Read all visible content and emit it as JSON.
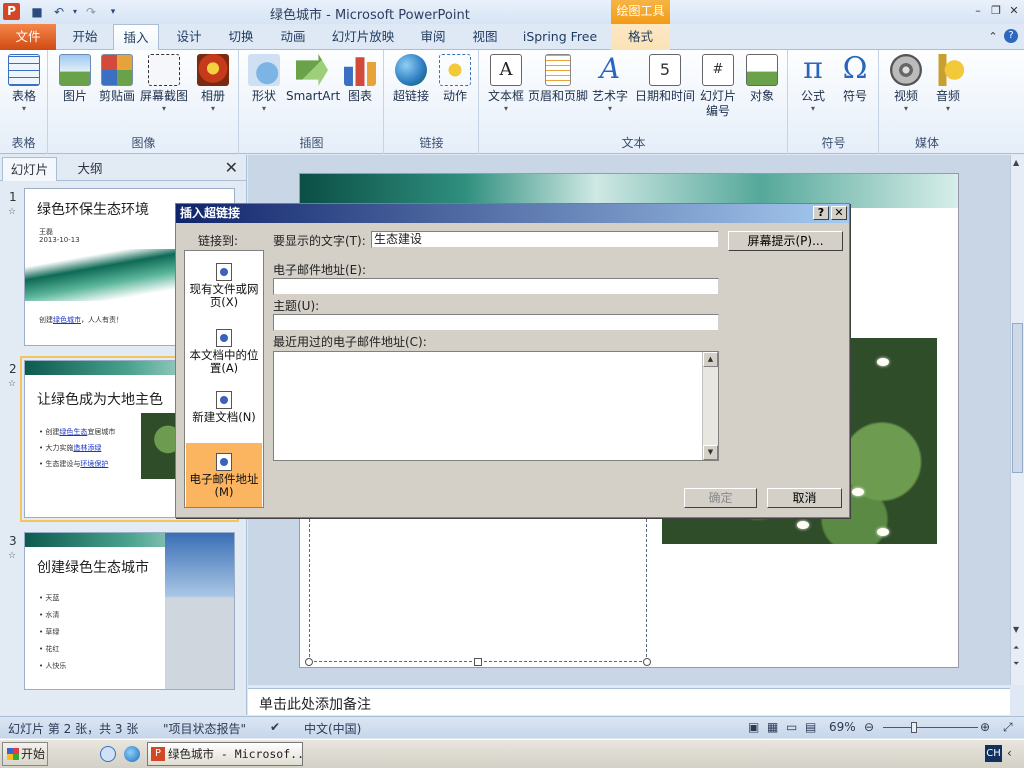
{
  "window": {
    "title": "绿色城市 - Microsoft PowerPoint",
    "app_icon": "P",
    "contextual_tab": "绘图工具"
  },
  "tabs": [
    "文件",
    "开始",
    "插入",
    "设计",
    "切换",
    "动画",
    "幻灯片放映",
    "审阅",
    "视图",
    "iSpring Free",
    "格式"
  ],
  "active_tab": "插入",
  "ribbon": {
    "groups": [
      {
        "label": "表格",
        "buttons": [
          {
            "label": "表格",
            "icon": "table-icon"
          }
        ]
      },
      {
        "label": "图像",
        "buttons": [
          {
            "label": "图片",
            "icon": "picture-icon"
          },
          {
            "label": "剪贴画",
            "icon": "clipart-icon"
          },
          {
            "label": "屏幕截图",
            "icon": "screenshot-icon"
          },
          {
            "label": "相册",
            "icon": "photo-album-icon"
          }
        ]
      },
      {
        "label": "插图",
        "buttons": [
          {
            "label": "形状",
            "icon": "shapes-icon"
          },
          {
            "label": "SmartArt",
            "icon": "smartart-icon"
          },
          {
            "label": "图表",
            "icon": "chart-icon"
          }
        ]
      },
      {
        "label": "链接",
        "buttons": [
          {
            "label": "超链接",
            "icon": "hyperlink-icon"
          },
          {
            "label": "动作",
            "icon": "action-icon"
          }
        ]
      },
      {
        "label": "文本",
        "buttons": [
          {
            "label": "文本框",
            "icon": "textbox-icon"
          },
          {
            "label": "页眉和页脚",
            "icon": "header-footer-icon"
          },
          {
            "label": "艺术字",
            "icon": "wordart-icon"
          },
          {
            "label": "日期和时间",
            "icon": "date-time-icon"
          },
          {
            "label": "幻灯片",
            "label2": "编号",
            "icon": "slide-number-icon"
          },
          {
            "label": "对象",
            "icon": "object-icon"
          }
        ]
      },
      {
        "label": "符号",
        "buttons": [
          {
            "label": "公式",
            "icon": "equation-icon",
            "glyph": "π"
          },
          {
            "label": "符号",
            "icon": "symbol-icon",
            "glyph": "Ω"
          }
        ]
      },
      {
        "label": "媒体",
        "buttons": [
          {
            "label": "视频",
            "icon": "video-icon"
          },
          {
            "label": "音频",
            "icon": "audio-icon"
          }
        ]
      }
    ]
  },
  "panel": {
    "tabs": [
      "幻灯片",
      "大纲"
    ],
    "close": "✕",
    "slides": [
      {
        "num": "1",
        "title": "绿色环保生态环境",
        "lines": [
          "王磊",
          "2013-10-13"
        ],
        "footer_pre": "创建",
        "footer_link": "绿色城市",
        "footer_post": "，人人有责！"
      },
      {
        "num": "2",
        "title": "让绿色成为大地主色",
        "bullets": [
          {
            "pre": "创建",
            "link": "绿色生态",
            "post": "宜居城市"
          },
          {
            "pre": "大力实施",
            "link": "造林添绿",
            "post": ""
          },
          {
            "pre": "生态建设与",
            "link": "环境保护",
            "post": ""
          }
        ]
      },
      {
        "num": "3",
        "title": "创建绿色生态城市",
        "bullets": [
          "天蓝",
          "水清",
          "草绿",
          "花红",
          "人快乐"
        ]
      }
    ]
  },
  "dialog": {
    "title": "插入超链接",
    "help": "?",
    "close": "✕",
    "link_to_label": "链接到:",
    "link_to": [
      "现有文件或网页(X)",
      "本文档中的位置(A)",
      "新建文档(N)",
      "电子邮件地址(M)"
    ],
    "active_link_to": "电子邮件地址(M)",
    "display_text_label": "要显示的文字(T):",
    "display_text_value": "生态建设",
    "screentip_button": "屏幕提示(P)...",
    "email_label": "电子邮件地址(E):",
    "email_value": "",
    "subject_label": "主题(U):",
    "subject_value": "",
    "recent_label": "最近用过的电子邮件地址(C):",
    "ok": "确定",
    "cancel": "取消"
  },
  "notes_placeholder": "单击此处添加备注",
  "statusbar": {
    "slide_info": "幻灯片 第 2 张，共 3 张",
    "theme": "\"项目状态报告\"",
    "language": "中文(中国)",
    "zoom": "69%",
    "zoom_level": 0.69
  },
  "taskbar": {
    "start": "开始",
    "task_ppt": "绿色城市 - Microsof...",
    "ime": "CH"
  }
}
